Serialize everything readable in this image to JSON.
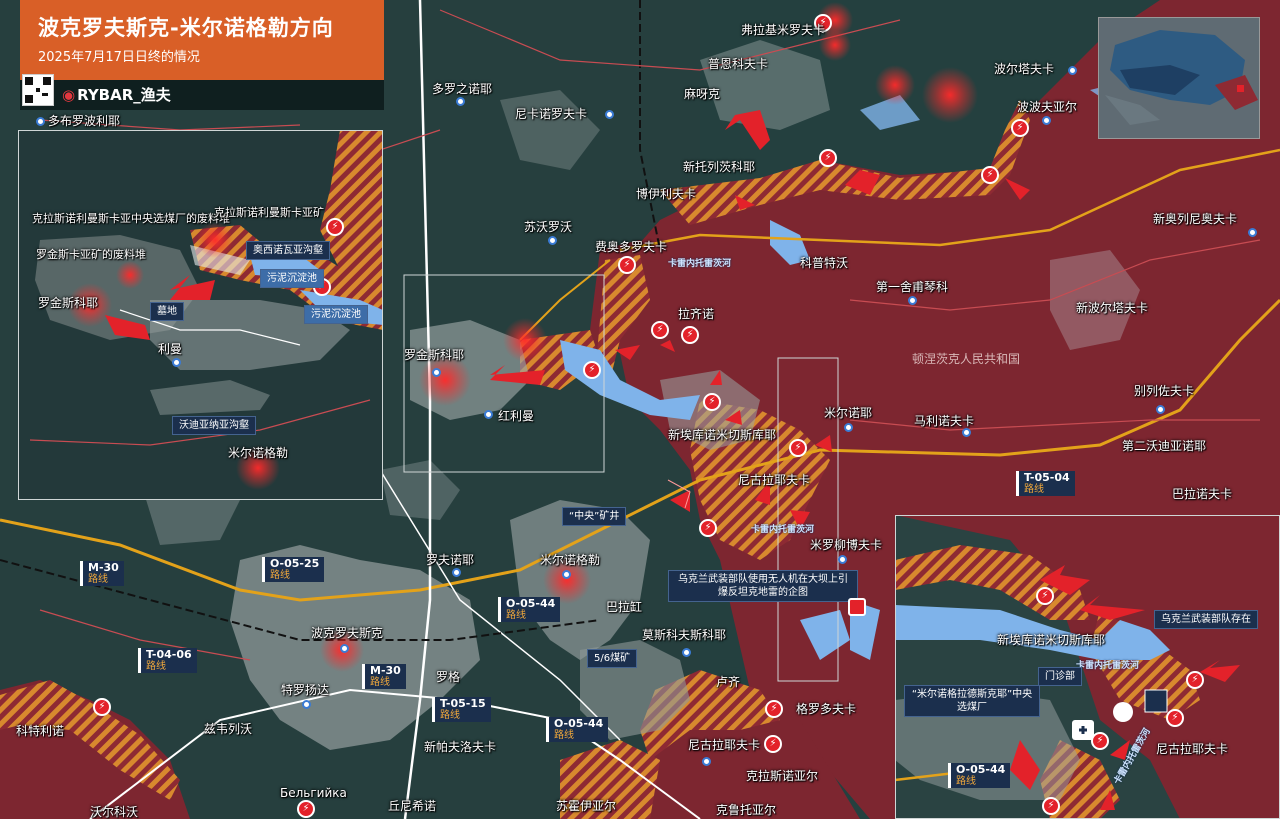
{
  "header": {
    "title": "波克罗夫斯克-米尔诺格勒方向",
    "subtitle": "2025年7月17日日终的情况",
    "brand": "RYBAR_渔夫"
  },
  "colors": {
    "russian_controlled": "#8e2a33",
    "front_hatch": "#d8892e",
    "urban": "#c9cfcf",
    "water": "#7fb3ea",
    "attack_arrow": "#e3222a",
    "header_bg": "#d95f27",
    "road_label_bg": "#1b2f4d"
  },
  "inset_left": {
    "places": {
      "dobropillia": "多布罗波利耶",
      "mine_heap": "克拉斯诺利曼斯卡亚中央选煤厂的废料堆",
      "krasnolim_mine": "克拉斯诺利曼斯卡亚矿",
      "rodinske_heap": "罗金斯卡亚矿的废料堆",
      "oseevska": "奥西诺瓦亚沟壑",
      "mud_pool_1": "污泥沉淀池",
      "mud_pool_2": "污泥沉淀池",
      "rodinske": "罗金斯科耶",
      "cemetery": "墓地",
      "liman": "利曼",
      "vodiana": "沃迪亚纳亚沟壑",
      "myrnohrad": "米尔诺格勒"
    }
  },
  "places": {
    "frolovo": "弗拉基米罗夫卡",
    "puenkovo": "普恩科夫卡",
    "zolotiy": "多罗之诺耶",
    "nikanorovka": "尼卡诺罗夫卡",
    "mayak": "麻呀克",
    "novotoretske": "新托列茨科耶",
    "boguslavka": "博伊利夫卡",
    "sukhoi": "苏沃罗沃",
    "fedorovka": "费奥多罗夫卡",
    "zolotyi_kolodets": "波尔塔夫卡",
    "popov_yar": "波波夫亚尔",
    "new_pilnik": "新奥列尼奥夫卡",
    "kpril": "科普特沃",
    "bezym": "第一舍甫琴科",
    "novo_poltav": "新波尔塔夫卡",
    "lazir": "拉齐诺",
    "dnr_label": "顿涅茨克人民共和国",
    "rodinske_main": "罗金斯科耶",
    "krasnyi_liman": "红利曼",
    "novoekonomichne": "新埃库诺米切斯库耶",
    "mirne": "米尔诺耶",
    "malinovka": "马利诺夫卡",
    "belitske": "别列佐夫卡",
    "second_stepovoe": "第二沃迪亚诺耶",
    "nikolaevka": "尼古拉耶夫卡",
    "baliaykov": "巴拉诺夫卡",
    "myroliubovka": "米罗柳博夫卡",
    "central_mine": "“中央”矿井",
    "myrnohrad_main": "米尔诺格勒",
    "rovnoe": "罗夫诺耶",
    "balagan": "巴拉缸",
    "moskovske": "莫斯科夫斯科耶",
    "pokrovsk": "波克罗夫斯克",
    "mine56": "5/6煤矿",
    "luch": "卢齐",
    "shevchenko": "特罗扬达",
    "lysivka": "罗格",
    "hrodivka": "格罗多夫卡",
    "novopavlivka": "新帕夫洛夫卡",
    "nikolaevka2": "尼古拉耶夫卡",
    "krasny": "克拉斯诺亚尔",
    "zvirove": "兹韦列沃",
    "kotlino": "科特利诺",
    "bilhivka": "Бельгийка",
    "zelene": "丘尼希诺",
    "sukhyi_yar": "苏霍伊亚尔",
    "krutoyar": "克鲁托亚尔",
    "volhovo": "沃尔科沃",
    "bottom_right": "尼古拉耶夫卡"
  },
  "roads": [
    {
      "code": "M-30",
      "sub": "路线"
    },
    {
      "code": "O-05-25",
      "sub": "路线"
    },
    {
      "code": "O-05-44",
      "sub": "路线"
    },
    {
      "code": "T-04-06",
      "sub": "路线"
    },
    {
      "code": "M-30",
      "sub": "路线"
    },
    {
      "code": "T-05-15",
      "sub": "路线"
    },
    {
      "code": "O-05-44",
      "sub": "路线"
    },
    {
      "code": "T-05-04",
      "sub": "路线"
    },
    {
      "code": "O-05-44",
      "sub": "路线"
    }
  ],
  "rivers": {
    "main": "卡雷内托雷茨河",
    "south": "卡雷内托雷茨河",
    "inset_br": "卡雷内托雷茨河",
    "inset_br_low": "卡雷内托雷茨河"
  },
  "notes": {
    "drone_strike": "乌克兰武装部队使用无人机在大坝上引爆反坦克地雷的企图",
    "ua_presence": "乌克兰武装部队存在"
  },
  "inset_br": {
    "novoekonomichne": "新埃库诺米切斯库耶",
    "clinic": "门诊部",
    "mine": "“米尔诺格拉德斯克耶”中央选煤厂",
    "nikolaevka": "尼古拉耶夫卡"
  }
}
